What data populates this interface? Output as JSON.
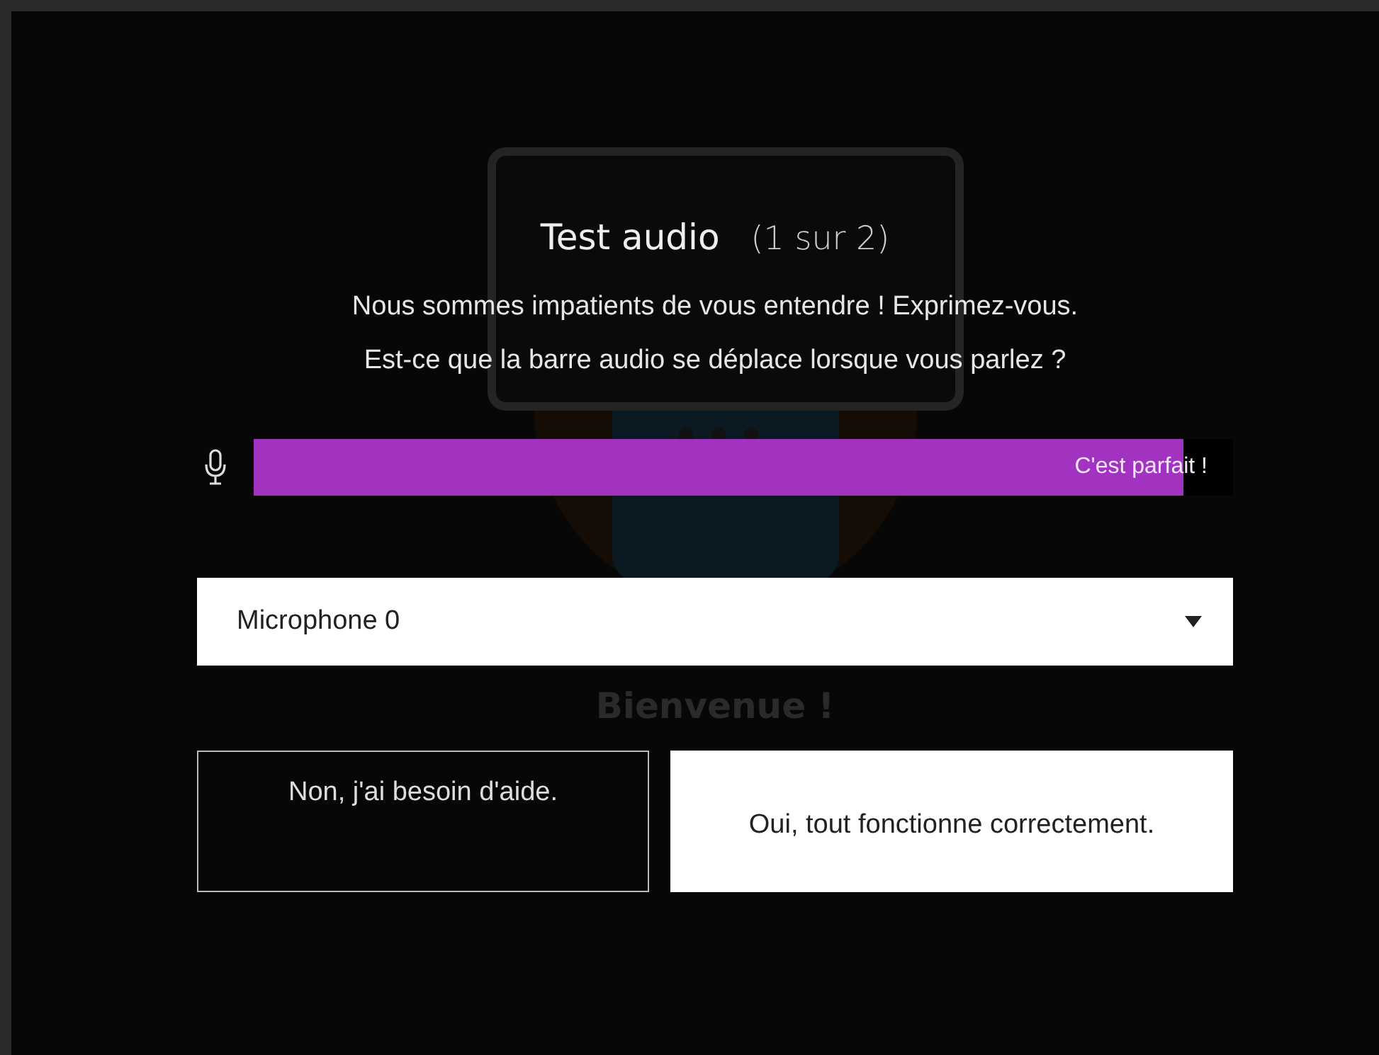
{
  "background": {
    "heading": "Bienvenue !"
  },
  "dialog": {
    "title": "Test audio",
    "step": "(1 sur 2)",
    "lines": [
      "Nous sommes impatients de vous entendre ! Exprimez-vous.",
      "Est-ce que la barre audio se déplace lorsque vous parlez ?"
    ],
    "meter": {
      "level": 0.95,
      "label": "C'est parfait !"
    },
    "device_select": {
      "value": "Microphone 0"
    },
    "buttons": [
      {
        "label": "Non, j'ai besoin d'aide.",
        "kind": "secondary"
      },
      {
        "label": "Oui, tout fonctionne correctement.",
        "kind": "primary"
      }
    ]
  }
}
